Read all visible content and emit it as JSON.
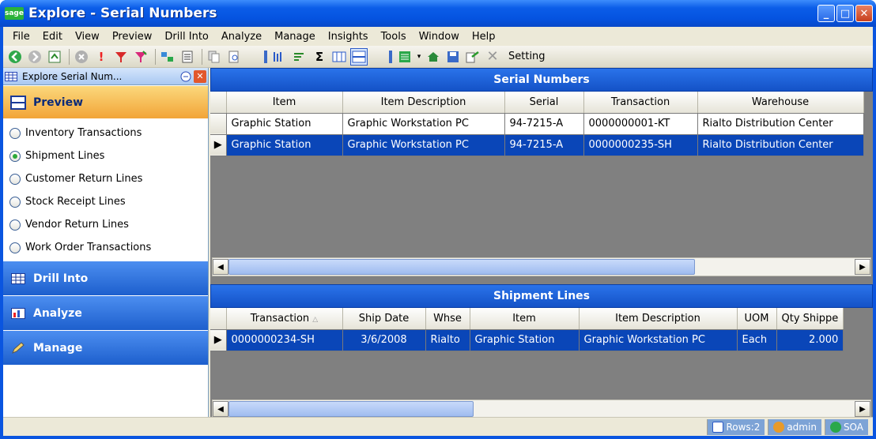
{
  "window": {
    "app_badge": "sage",
    "title": "Explore - Serial Numbers"
  },
  "menu": [
    "File",
    "Edit",
    "View",
    "Preview",
    "Drill Into",
    "Analyze",
    "Manage",
    "Insights",
    "Tools",
    "Window",
    "Help"
  ],
  "toolbar": {
    "setting_label": "Setting"
  },
  "left_pane": {
    "header": "Explore  Serial Num...",
    "groups": {
      "preview": "Preview",
      "drill_into": "Drill Into",
      "analyze": "Analyze",
      "manage": "Manage"
    },
    "options": [
      {
        "label": "Inventory Transactions",
        "selected": false
      },
      {
        "label": "Shipment Lines",
        "selected": true
      },
      {
        "label": "Customer Return Lines",
        "selected": false
      },
      {
        "label": "Stock Receipt Lines",
        "selected": false
      },
      {
        "label": "Vendor Return Lines",
        "selected": false
      },
      {
        "label": "Work Order Transactions",
        "selected": false
      }
    ]
  },
  "serial_grid": {
    "title": "Serial Numbers",
    "columns": [
      "Item",
      "Item Description",
      "Serial",
      "Transaction",
      "Warehouse"
    ],
    "rows": [
      [
        "Graphic Station",
        "Graphic Workstation PC",
        "94-7215-A",
        "0000000001-KT",
        "Rialto Distribution Center"
      ],
      [
        "Graphic Station",
        "Graphic Workstation PC",
        "94-7215-A",
        "0000000235-SH",
        "Rialto Distribution Center"
      ]
    ]
  },
  "shipment_grid": {
    "title": "Shipment Lines",
    "columns": [
      "Transaction",
      "Ship Date",
      "Whse",
      "Item",
      "Item Description",
      "UOM",
      "Qty Shippe"
    ],
    "rows": [
      [
        "0000000234-SH",
        "3/6/2008",
        "Rialto",
        "Graphic Station",
        "Graphic Workstation PC",
        "Each",
        "2.000"
      ]
    ]
  },
  "status": {
    "rows": "Rows:2",
    "user": "admin",
    "company": "SOA"
  }
}
